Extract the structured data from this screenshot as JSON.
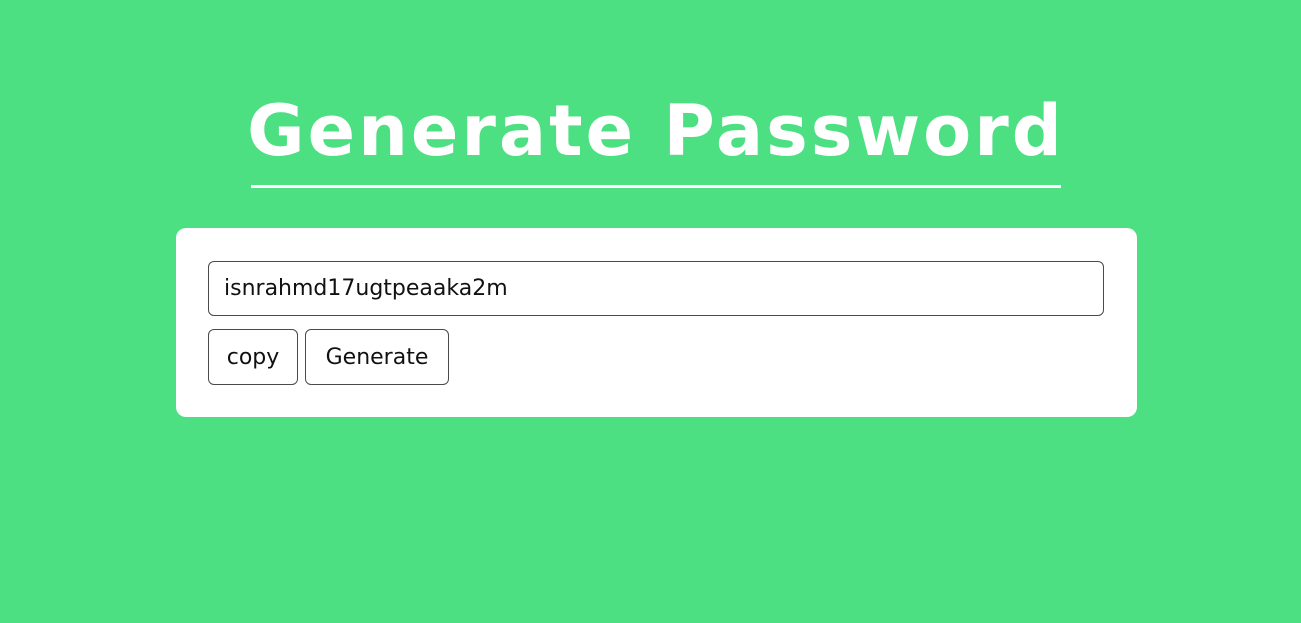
{
  "header": {
    "title": "Generate Password"
  },
  "generator": {
    "password_value": "isnrahmd17ugtpeaaka2m",
    "copy_label": "copy",
    "generate_label": "Generate"
  },
  "colors": {
    "background": "#4ce083",
    "card": "#ffffff",
    "title": "#ffffff"
  }
}
